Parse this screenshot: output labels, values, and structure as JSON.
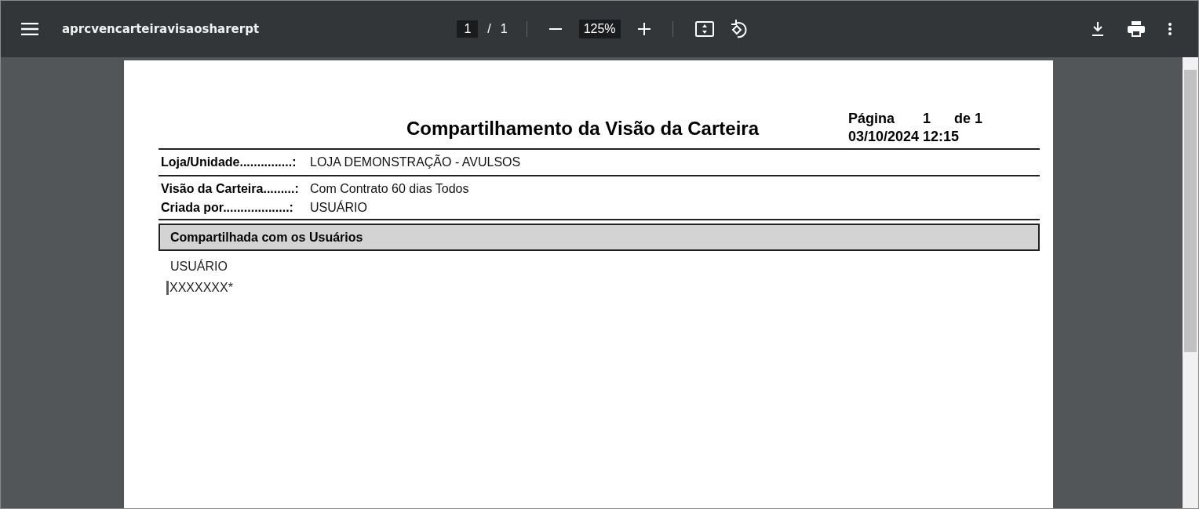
{
  "toolbar": {
    "title": "aprcvencarteiravisaosharerpt",
    "page_current": "1",
    "page_separator": "/",
    "page_total": "1",
    "zoom": "125%"
  },
  "report": {
    "title": "Compartilhamento da Visão da Carteira",
    "page_label": "Página",
    "page_number": "1",
    "page_of": "de 1",
    "datetime": "03/10/2024 12:15",
    "store": {
      "label": "Loja/Unidade...............:",
      "value": "LOJA DEMONSTRAÇÃO - AVULSOS"
    },
    "fields": [
      {
        "label": "Visão da Carteira.........:",
        "value": "Com Contrato 60 dias Todos"
      },
      {
        "label": "Criada por...................:",
        "value": "USUÁRIO"
      }
    ],
    "section_title": "Compartilhada com os Usuários",
    "users": [
      {
        "text": "USUÁRIO",
        "cursor": false
      },
      {
        "text": "XXXXXXX*",
        "cursor": true
      }
    ]
  }
}
